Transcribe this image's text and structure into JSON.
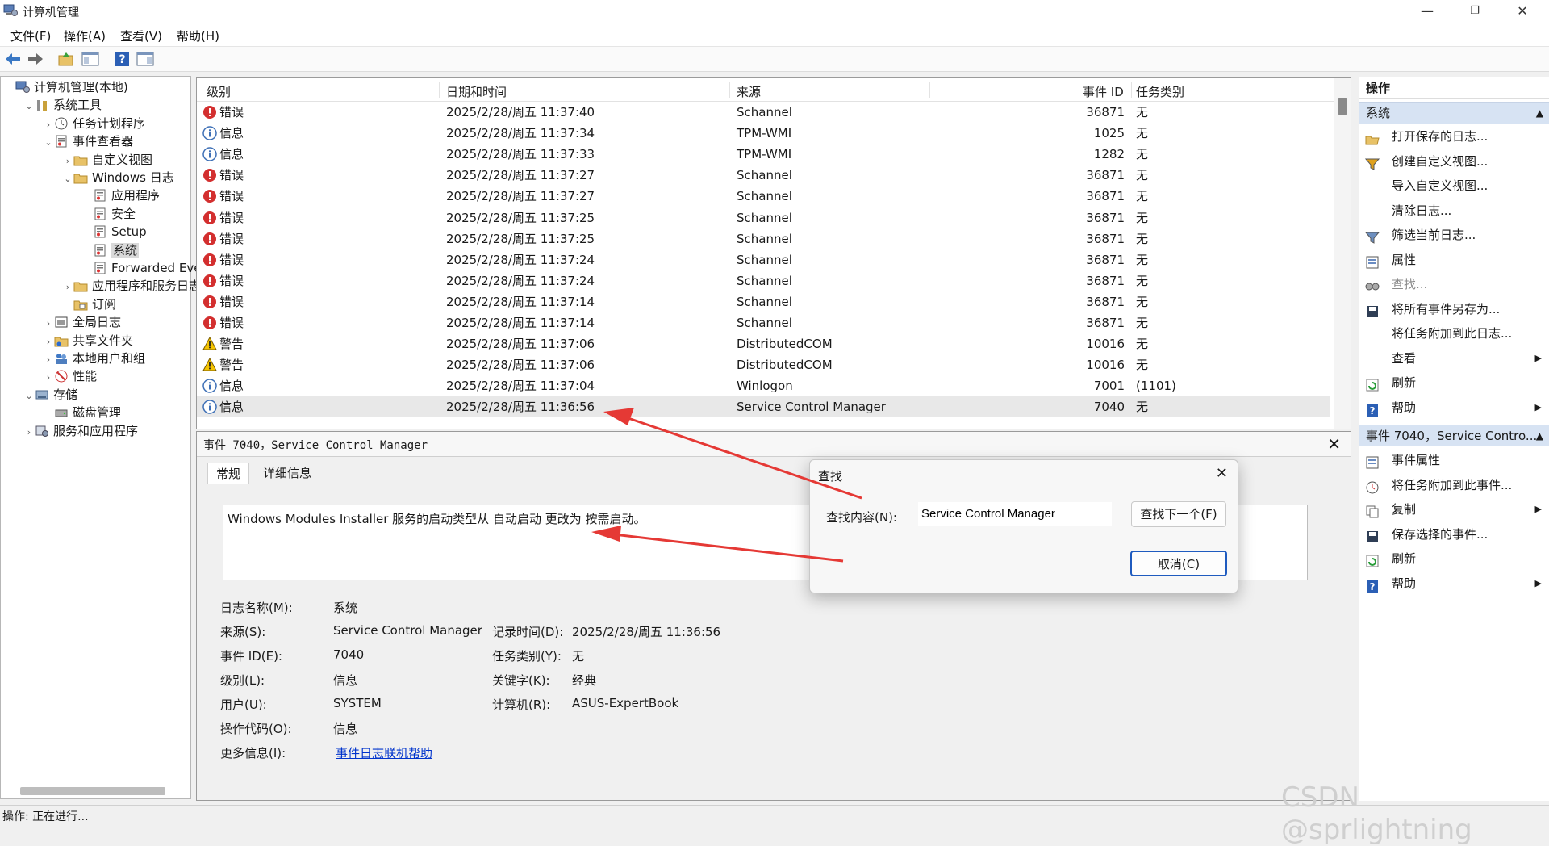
{
  "window": {
    "title": "计算机管理",
    "min": "—",
    "max": "❐",
    "close": "✕"
  },
  "menu": [
    "文件(F)",
    "操作(A)",
    "查看(V)",
    "帮助(H)"
  ],
  "tree": [
    {
      "label": "计算机管理(本地)",
      "caret": "",
      "depth": 0,
      "icon": "computer-management-icon"
    },
    {
      "label": "系统工具",
      "caret": "⌄",
      "depth": 1,
      "icon": "tools-icon"
    },
    {
      "label": "任务计划程序",
      "caret": "›",
      "depth": 2,
      "icon": "clock-icon"
    },
    {
      "label": "事件查看器",
      "caret": "⌄",
      "depth": 2,
      "icon": "event-viewer-icon"
    },
    {
      "label": "自定义视图",
      "caret": "›",
      "depth": 3,
      "icon": "folder-icon"
    },
    {
      "label": "Windows 日志",
      "caret": "⌄",
      "depth": 3,
      "icon": "folder-icon"
    },
    {
      "label": "应用程序",
      "caret": "",
      "depth": 4,
      "icon": "log-icon"
    },
    {
      "label": "安全",
      "caret": "",
      "depth": 4,
      "icon": "log-icon"
    },
    {
      "label": "Setup",
      "caret": "",
      "depth": 4,
      "icon": "log-icon"
    },
    {
      "label": "系统",
      "caret": "",
      "depth": 4,
      "icon": "log-icon",
      "selected": true
    },
    {
      "label": "Forwarded Even",
      "caret": "",
      "depth": 4,
      "icon": "log-icon"
    },
    {
      "label": "应用程序和服务日志",
      "caret": "›",
      "depth": 3,
      "icon": "folder-icon"
    },
    {
      "label": "订阅",
      "caret": "",
      "depth": 3,
      "icon": "subscription-icon"
    },
    {
      "label": "全局日志",
      "caret": "›",
      "depth": 2,
      "icon": "global-log-icon"
    },
    {
      "label": "共享文件夹",
      "caret": "›",
      "depth": 2,
      "icon": "shared-folder-icon"
    },
    {
      "label": "本地用户和组",
      "caret": "›",
      "depth": 2,
      "icon": "users-icon"
    },
    {
      "label": "性能",
      "caret": "›",
      "depth": 2,
      "icon": "performance-icon"
    },
    {
      "label": "存储",
      "caret": "⌄",
      "depth": 1,
      "icon": "storage-icon"
    },
    {
      "label": "磁盘管理",
      "caret": "",
      "depth": 2,
      "icon": "disk-icon"
    },
    {
      "label": "服务和应用程序",
      "caret": "›",
      "depth": 1,
      "icon": "services-icon"
    }
  ],
  "list": {
    "headers": [
      "级别",
      "日期和时间",
      "来源",
      "事件 ID",
      "任务类别"
    ],
    "rows": [
      {
        "level": "错误",
        "type": "error",
        "datetime": "2025/2/28/周五 11:37:40",
        "source": "Schannel",
        "id": "36871",
        "category": "无"
      },
      {
        "level": "信息",
        "type": "info",
        "datetime": "2025/2/28/周五 11:37:34",
        "source": "TPM-WMI",
        "id": "1025",
        "category": "无"
      },
      {
        "level": "信息",
        "type": "info",
        "datetime": "2025/2/28/周五 11:37:33",
        "source": "TPM-WMI",
        "id": "1282",
        "category": "无"
      },
      {
        "level": "错误",
        "type": "error",
        "datetime": "2025/2/28/周五 11:37:27",
        "source": "Schannel",
        "id": "36871",
        "category": "无"
      },
      {
        "level": "错误",
        "type": "error",
        "datetime": "2025/2/28/周五 11:37:27",
        "source": "Schannel",
        "id": "36871",
        "category": "无"
      },
      {
        "level": "错误",
        "type": "error",
        "datetime": "2025/2/28/周五 11:37:25",
        "source": "Schannel",
        "id": "36871",
        "category": "无"
      },
      {
        "level": "错误",
        "type": "error",
        "datetime": "2025/2/28/周五 11:37:25",
        "source": "Schannel",
        "id": "36871",
        "category": "无"
      },
      {
        "level": "错误",
        "type": "error",
        "datetime": "2025/2/28/周五 11:37:24",
        "source": "Schannel",
        "id": "36871",
        "category": "无"
      },
      {
        "level": "错误",
        "type": "error",
        "datetime": "2025/2/28/周五 11:37:24",
        "source": "Schannel",
        "id": "36871",
        "category": "无"
      },
      {
        "level": "错误",
        "type": "error",
        "datetime": "2025/2/28/周五 11:37:14",
        "source": "Schannel",
        "id": "36871",
        "category": "无"
      },
      {
        "level": "错误",
        "type": "error",
        "datetime": "2025/2/28/周五 11:37:14",
        "source": "Schannel",
        "id": "36871",
        "category": "无"
      },
      {
        "level": "警告",
        "type": "warning",
        "datetime": "2025/2/28/周五 11:37:06",
        "source": "DistributedCOM",
        "id": "10016",
        "category": "无"
      },
      {
        "level": "警告",
        "type": "warning",
        "datetime": "2025/2/28/周五 11:37:06",
        "source": "DistributedCOM",
        "id": "10016",
        "category": "无"
      },
      {
        "level": "信息",
        "type": "info",
        "datetime": "2025/2/28/周五 11:37:04",
        "source": "Winlogon",
        "id": "7001",
        "category": "(1101)"
      },
      {
        "level": "信息",
        "type": "info",
        "datetime": "2025/2/28/周五 11:36:56",
        "source": "Service Control Manager",
        "id": "7040",
        "category": "无",
        "selected": true
      }
    ]
  },
  "detail": {
    "title": "事件 7040，Service Control Manager",
    "close": "✕",
    "tabs": [
      "常规",
      "详细信息"
    ],
    "description": "Windows Modules Installer 服务的启动类型从 自动启动 更改为 按需启动。",
    "props": {
      "log_name_label": "日志名称(M):",
      "log_name": "系统",
      "source_label": "来源(S):",
      "source": "Service Control Manager",
      "logged_label": "记录时间(D):",
      "logged": "2025/2/28/周五 11:36:56",
      "event_id_label": "事件 ID(E):",
      "event_id": "7040",
      "task_label": "任务类别(Y):",
      "task": "无",
      "level_label": "级别(L):",
      "level": "信息",
      "keywords_label": "关键字(K):",
      "keywords": "经典",
      "user_label": "用户(U):",
      "user": "SYSTEM",
      "computer_label": "计算机(R):",
      "computer": "ASUS-ExpertBook",
      "opcode_label": "操作代码(O):",
      "opcode": "信息",
      "more_label": "更多信息(I):",
      "more_link": "事件日志联机帮助"
    }
  },
  "actions": {
    "header": "操作",
    "section1": "系统",
    "items1": [
      {
        "label": "打开保存的日志...",
        "icon": "open-log-icon"
      },
      {
        "label": "创建自定义视图...",
        "icon": "create-view-icon"
      },
      {
        "label": "导入自定义视图...",
        "icon": ""
      },
      {
        "label": "清除日志...",
        "icon": ""
      },
      {
        "label": "筛选当前日志...",
        "icon": "filter-icon"
      },
      {
        "label": "属性",
        "icon": "properties-icon"
      },
      {
        "label": "查找...",
        "icon": "find-icon",
        "disabled": true
      },
      {
        "label": "将所有事件另存为...",
        "icon": "save-icon"
      },
      {
        "label": "将任务附加到此日志...",
        "icon": ""
      },
      {
        "label": "查看",
        "icon": "",
        "submenu": true
      },
      {
        "label": "刷新",
        "icon": "refresh-icon"
      },
      {
        "label": "帮助",
        "icon": "help-icon",
        "submenu": true
      }
    ],
    "section2": "事件 7040，Service Contro...",
    "items2": [
      {
        "label": "事件属性",
        "icon": "properties-icon"
      },
      {
        "label": "将任务附加到此事件...",
        "icon": "task-icon"
      },
      {
        "label": "复制",
        "icon": "copy-icon",
        "submenu": true
      },
      {
        "label": "保存选择的事件...",
        "icon": "save-icon"
      },
      {
        "label": "刷新",
        "icon": "refresh-icon"
      },
      {
        "label": "帮助",
        "icon": "help-icon",
        "submenu": true
      }
    ]
  },
  "status": "操作: 正在进行...",
  "find_dialog": {
    "title": "查找",
    "close": "✕",
    "label": "查找内容(N):",
    "value": "Service Control Manager",
    "find_next": "查找下一个(F)",
    "cancel": "取消(C)"
  },
  "watermark": "CSDN @sprlightning",
  "colors": {
    "annotation_arrow": "#e53935",
    "error": "#d32f2f",
    "info": "#3d6fb6",
    "warning": "#f5c400",
    "selection": "#d9d9d9"
  }
}
